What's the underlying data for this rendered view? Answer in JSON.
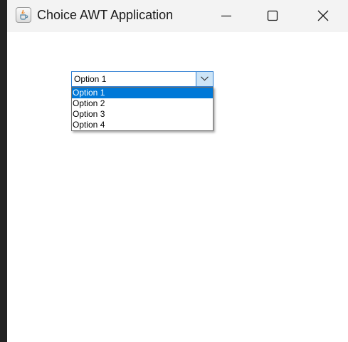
{
  "window": {
    "title": "Choice AWT Application",
    "icon": "java-cup-icon",
    "controls": [
      "minimize-icon",
      "maximize-icon",
      "close-icon"
    ]
  },
  "choice": {
    "selected": "Option 1",
    "arrow_icon": "chevron-down-icon",
    "options": [
      "Option 1",
      "Option 2",
      "Option 3",
      "Option 4"
    ],
    "highlighted_index": 0
  },
  "colors": {
    "accent": "#0078d7",
    "border": "#2a7bd1",
    "arrow_bg": "#cce4f7",
    "titlebar": "#f3f3f3"
  }
}
